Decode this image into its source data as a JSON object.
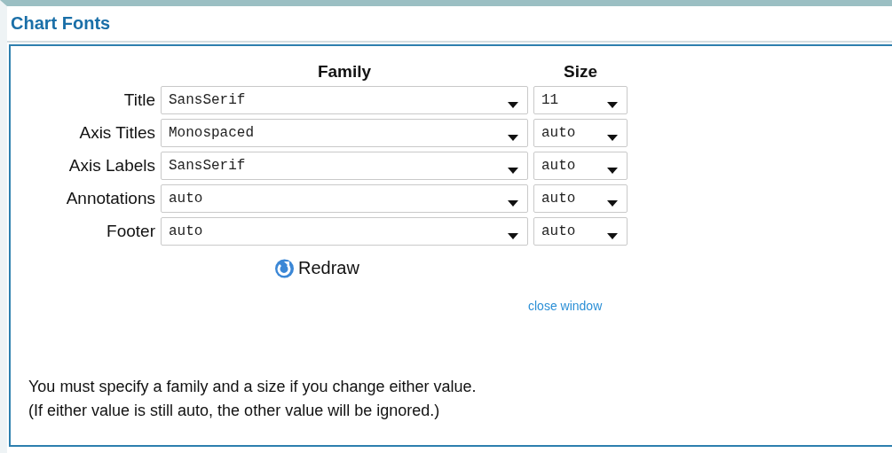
{
  "window": {
    "title": "Chart Fonts"
  },
  "columns": {
    "family": "Family",
    "size": "Size"
  },
  "rows": [
    {
      "label": "Title",
      "family": "SansSerif",
      "size": "11"
    },
    {
      "label": "Axis Titles",
      "family": "Monospaced",
      "size": "auto"
    },
    {
      "label": "Axis Labels",
      "family": "SansSerif",
      "size": "auto"
    },
    {
      "label": "Annotations",
      "family": "auto",
      "size": "auto"
    },
    {
      "label": "Footer",
      "family": "auto",
      "size": "auto"
    }
  ],
  "redraw_button": "Redraw",
  "close_link": "close window",
  "notes": [
    "You must specify a family and a size if you change either value.",
    "(If either value is still auto, the other value will be ignored.)"
  ]
}
